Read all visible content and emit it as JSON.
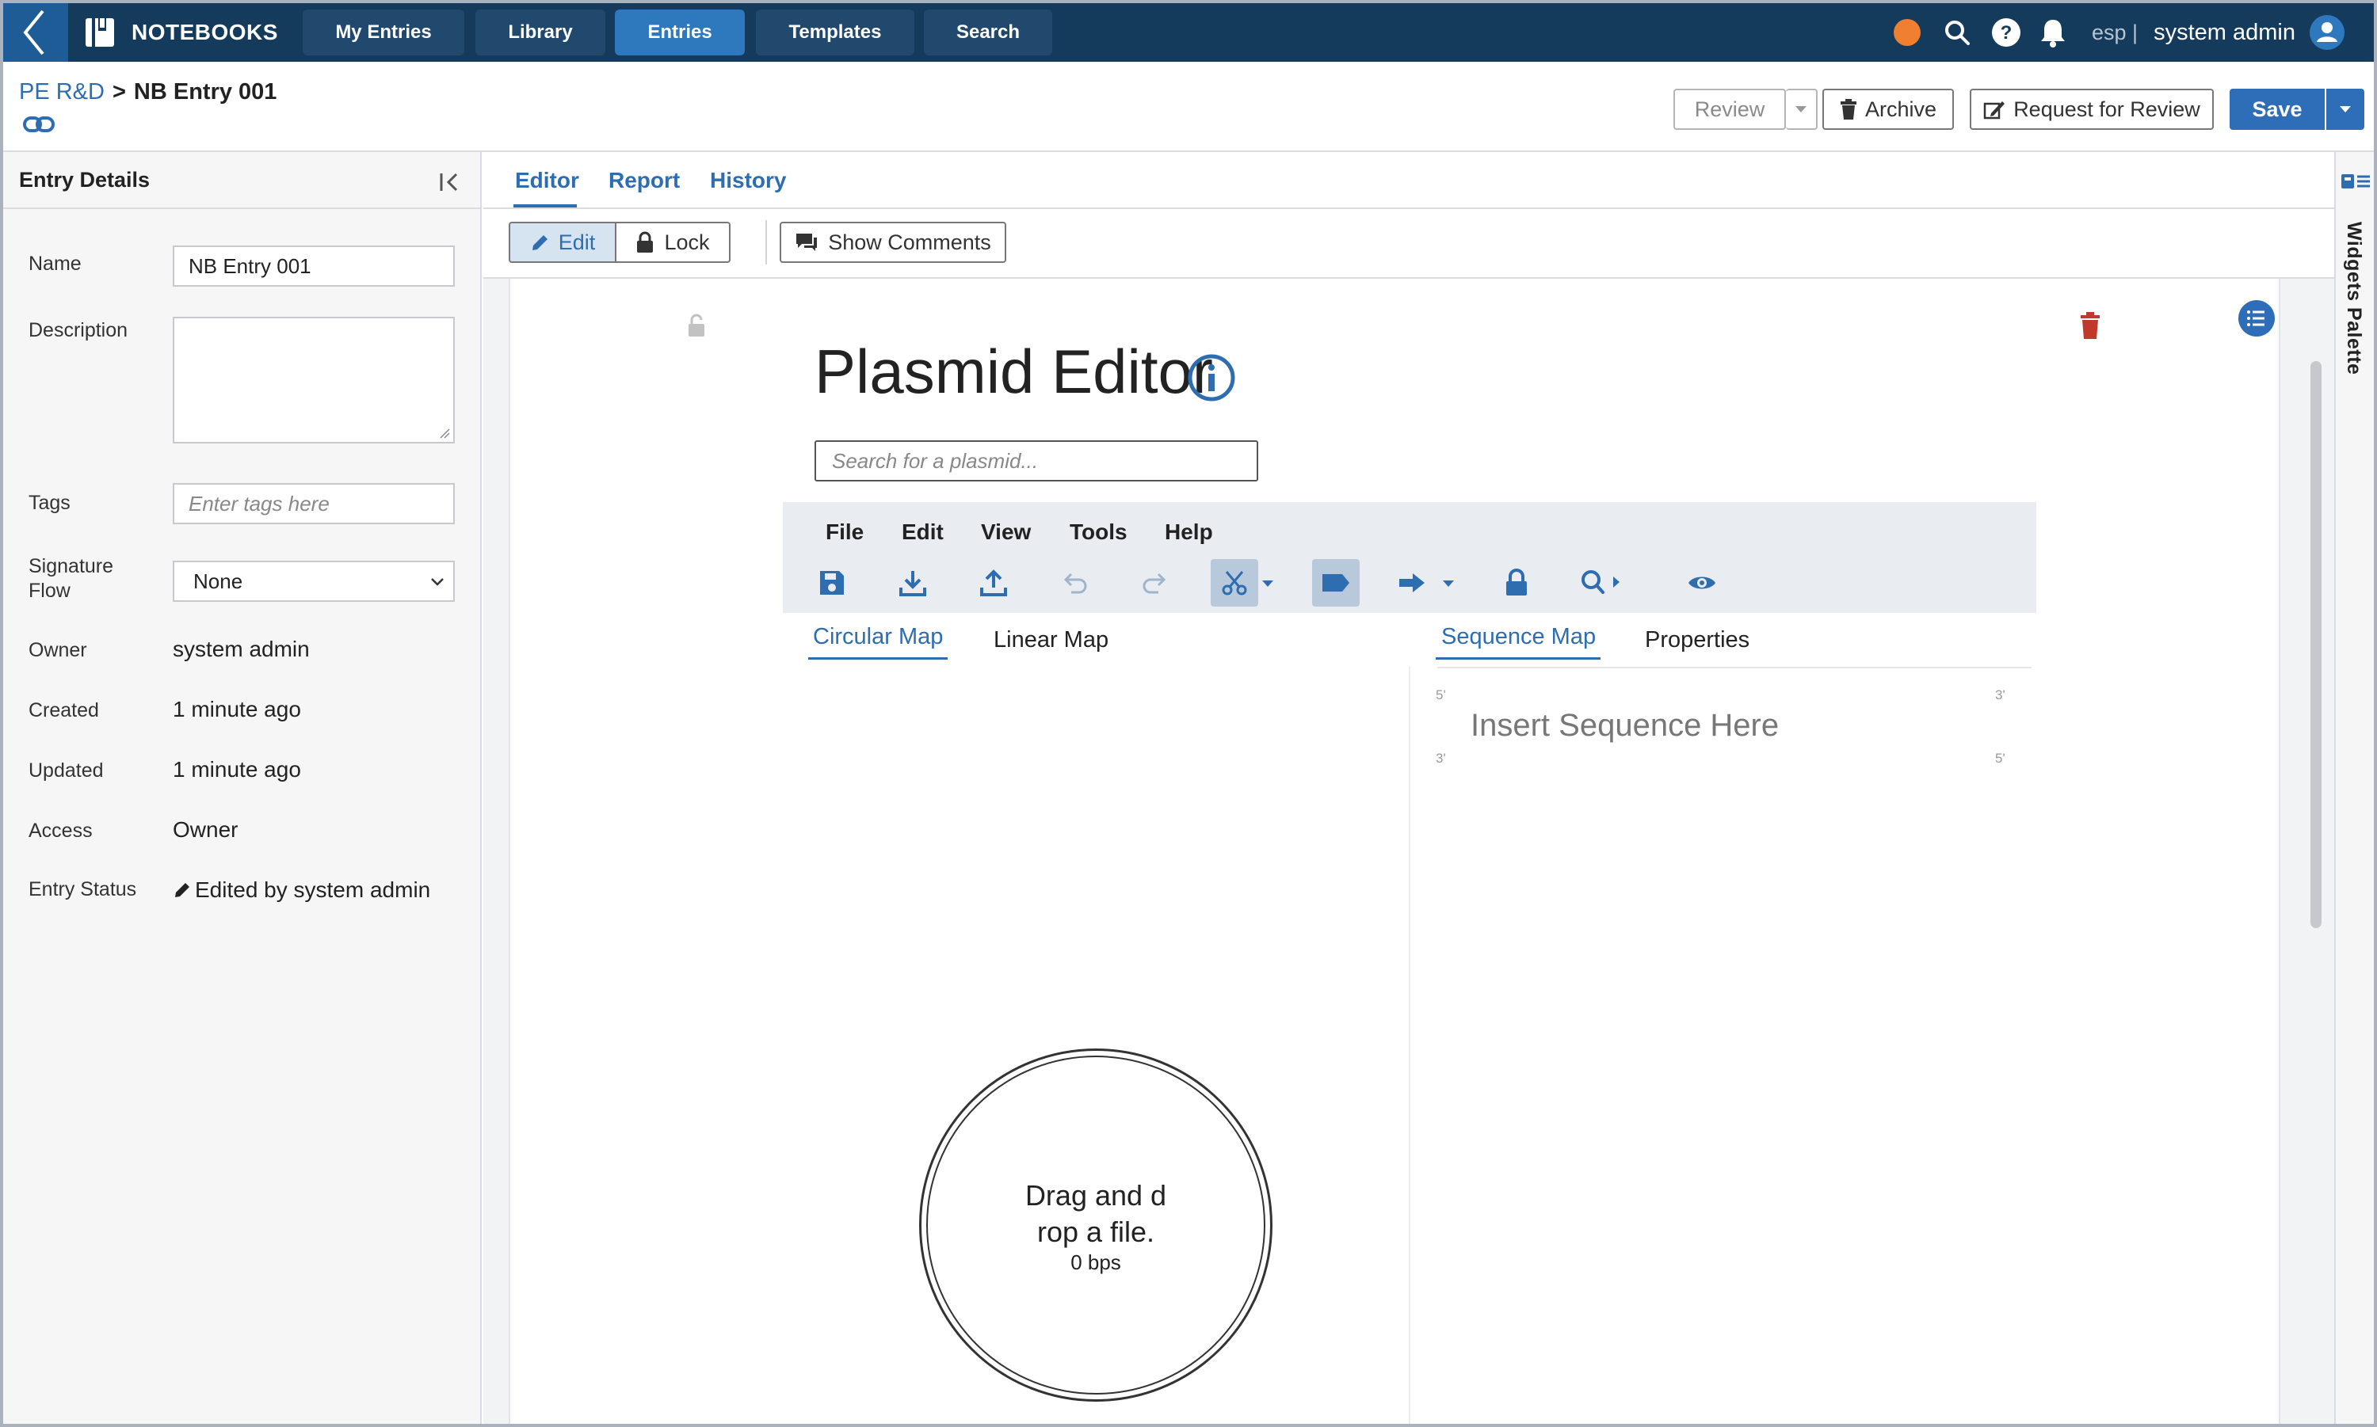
{
  "topbar": {
    "brand": "NOTEBOOKS",
    "nav": [
      "My Entries",
      "Library",
      "Entries",
      "Templates",
      "Search"
    ],
    "active_nav": "Entries",
    "lang": "esp |",
    "user": "system admin",
    "status_dot_color": "#f08030"
  },
  "breadcrumb": {
    "parent": "PE R&D",
    "separator": ">",
    "current": "NB Entry 001"
  },
  "actions": {
    "review": "Review",
    "archive": "Archive",
    "request_review": "Request for Review",
    "save": "Save"
  },
  "left_panel": {
    "title": "Entry Details",
    "fields": {
      "name_label": "Name",
      "name_value": "NB Entry 001",
      "description_label": "Description",
      "tags_label": "Tags",
      "tags_placeholder": "Enter tags here",
      "signature_label": "Signature Flow",
      "signature_value": "None",
      "owner_label": "Owner",
      "owner_value": "system admin",
      "created_label": "Created",
      "created_value": "1 minute ago",
      "updated_label": "Updated",
      "updated_value": "1 minute ago",
      "access_label": "Access",
      "access_value": "Owner",
      "status_label": "Entry Status",
      "status_value": "Edited by system admin"
    }
  },
  "tabs": [
    "Editor",
    "Report",
    "History"
  ],
  "active_tab": "Editor",
  "editor_toolbar": {
    "edit": "Edit",
    "lock": "Lock",
    "comments": "Show Comments"
  },
  "right_rail": {
    "label": "Widgets Palette"
  },
  "plasmid": {
    "title": "Plasmid Editor",
    "search_placeholder": "Search for a plasmid...",
    "menu": [
      "File",
      "Edit",
      "View",
      "Tools",
      "Help"
    ],
    "left_tabs": [
      "Circular Map",
      "Linear Map"
    ],
    "right_tabs": [
      "Sequence Map",
      "Properties"
    ],
    "seq_prompt": "Insert Sequence Here",
    "strand_marks": {
      "top_left": "5'",
      "top_right": "3'",
      "bottom_left": "3'",
      "bottom_right": "5'"
    },
    "drop_line1": "Drag and d",
    "drop_line2": "rop a file.",
    "drop_bps": "0 bps"
  },
  "colors": {
    "topbar": "#143a5c",
    "accent": "#2e6db8",
    "delete": "#c0392b"
  }
}
